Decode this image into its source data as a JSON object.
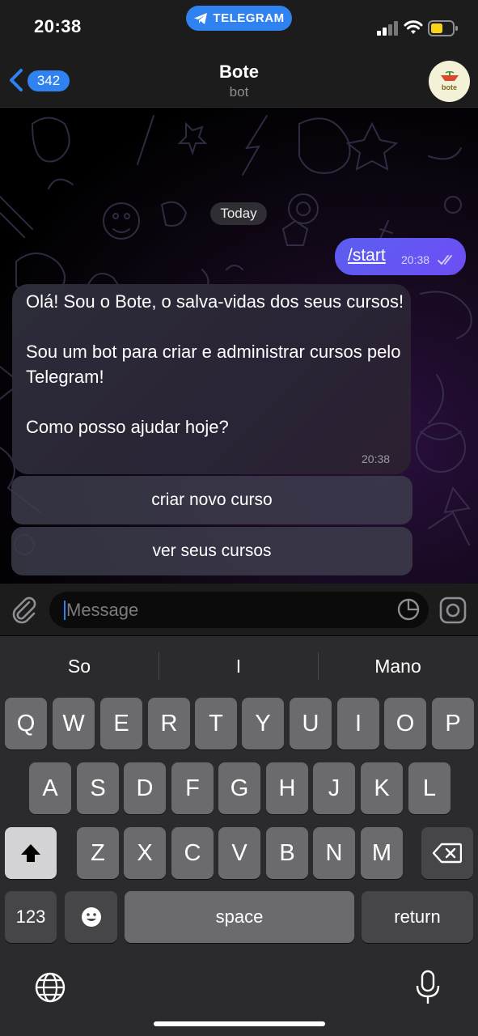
{
  "status_bar": {
    "time": "20:38",
    "app_pill": "TELEGRAM",
    "icons": [
      "signal-icon",
      "wifi-icon",
      "battery-icon"
    ]
  },
  "header": {
    "back_count": "342",
    "title": "Bote",
    "subtitle": "bot",
    "avatar_text": "bote"
  },
  "chat": {
    "date_divider": "Today",
    "messages": [
      {
        "direction": "outgoing",
        "text": "/start",
        "time": "20:38",
        "status": "read"
      },
      {
        "direction": "incoming",
        "text": "Olá! Sou o Bote, o salva-vidas dos seus cursos!\n\nSou um bot para criar e administrar cursos pelo Telegram!\n\nComo posso ajudar hoje?",
        "time": "20:38"
      }
    ],
    "inline_buttons": [
      "criar novo curso",
      "ver seus cursos"
    ]
  },
  "composer": {
    "placeholder": "Message",
    "icons": [
      "paperclip-icon",
      "sticker-icon",
      "camera-icon"
    ]
  },
  "keyboard": {
    "suggestions": [
      "So",
      "I",
      "Mano"
    ],
    "row1": [
      "Q",
      "W",
      "E",
      "R",
      "T",
      "Y",
      "U",
      "I",
      "O",
      "P"
    ],
    "row2": [
      "A",
      "S",
      "D",
      "F",
      "G",
      "H",
      "J",
      "K",
      "L"
    ],
    "row3": [
      "Z",
      "X",
      "C",
      "V",
      "B",
      "N",
      "M"
    ],
    "numbers_key": "123",
    "space_key": "space",
    "return_key": "return"
  },
  "colors": {
    "accent": "#2f82f0",
    "outgoing_bubble": "#5b5ef0",
    "incoming_bubble": "#2c2c38"
  }
}
